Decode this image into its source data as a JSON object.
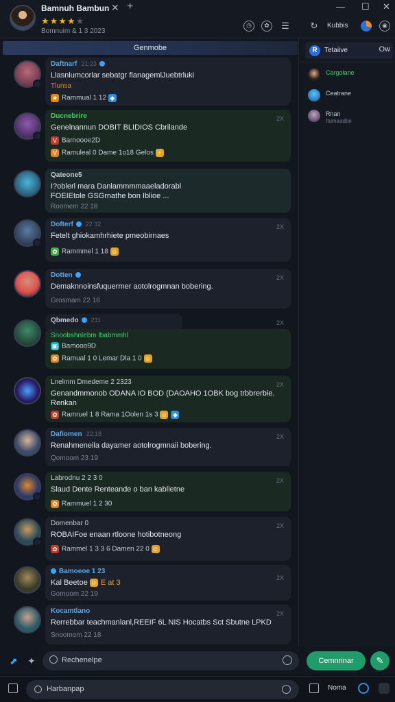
{
  "window": {
    "tab_title": "Bamnuh Bambun",
    "rating_stars_on": "★★★★",
    "rating_stars_off": "★",
    "subline": "Bomnuim & 1 3 2023",
    "close_glyph": "✕",
    "add_glyph": "+",
    "minimize_glyph": "—",
    "maximize_glyph": "☐",
    "window_close_glyph": "✕"
  },
  "toolbar": {
    "refresh_label": "Kubbis"
  },
  "feed": {
    "section_title": "Genmobe",
    "messages": [
      {
        "name": "Daftnarf",
        "time": "21:23",
        "text": "Llasnlumcorlar sebatgr flanagemlJuebtrluki",
        "sub": "Tlunsa",
        "meta": "Rammual 1 12",
        "x": ""
      },
      {
        "name": "Ducnebrire",
        "time": "",
        "text": "Genelnannun DOBIT BLIDIOS  Cbrilande",
        "sub": "",
        "meta1": "Barnoooe2D",
        "meta2": "Ramuleal 0  Dame 1o18  Gelos",
        "x": "2X"
      },
      {
        "name": "Qateone5",
        "time": "",
        "text": "I?oblerl mara Danlammmmaaeladorabl",
        "text2": "FOEIEtole GSGrnathe bon Iblioe ...",
        "sub": "Roomem 22 18",
        "x": ""
      },
      {
        "name": "Dofterf",
        "time": "22 32",
        "text": "Fetelt ghiokamhrhiete pmeobirnaes",
        "meta": "Rammmel 1 18",
        "x": "2X"
      },
      {
        "name": "Dotten",
        "time": "",
        "text": "Demaknnoinsfuquermer aotolrogmnan bobering.",
        "sub": "Grosmam 22 18",
        "x": "2X"
      },
      {
        "name": "Qbmedo",
        "time": "211",
        "text": "Snoobshnlebm lbabmmhl",
        "meta1": "Bamooo9D",
        "meta2": "Ramual 1 0  Lemar Dla 1 0",
        "x": "2X"
      },
      {
        "name": "Lnelmm Dmedeme 2 2323",
        "time": "",
        "text": "Genandmmonob ODANA IO BOD (DAOAHO 1OBK bog trbbrerbie.",
        "text2": "Renkan",
        "meta": "Ramruel 1 8  Rama 1Oolen 1s 3",
        "x": "2X"
      },
      {
        "name": "Dafiomen",
        "time": "22:18",
        "text": "Renahmeneila dayamer aotolrogmnaii bobering.",
        "sub": "Qomoom 23 19",
        "x": "2X"
      },
      {
        "name": "Labrodnu 2 2 3 0",
        "time": "",
        "text": "Slaud Dente Renteande o ban kablletne",
        "meta": "Rammuel 1 2 30",
        "x": "2X"
      },
      {
        "name": "Domenbar 0",
        "time": "",
        "text": "ROBAIFoe enaan rtloone hotibotneong",
        "meta": "Rammel 1 3 3 6 Damen 22 0",
        "x": "2X"
      },
      {
        "name": "Bamoeoe 1 23",
        "time": "",
        "text": "Kal Beetoe",
        "text_extra": "E at 3",
        "sub": "Gomoom 22 19",
        "x": "2X"
      },
      {
        "name": "Kocamtlano",
        "time": "",
        "text": "Rerrebbar teachmanlanl,REEIF 6L NIS Hocatbs Sct Sbutne LPKD",
        "sub": "Snoomom 22 18",
        "x": "2X"
      }
    ]
  },
  "right_panel": {
    "chip_label": "Tetaiive",
    "chip_icon": "R",
    "chip_more": "Ow",
    "items": [
      {
        "label": "Cargolane",
        "sub": ""
      },
      {
        "label": "Ceatrane",
        "sub": ""
      },
      {
        "label": "Rnan",
        "sub": "Itumaadbe"
      }
    ]
  },
  "composer": {
    "placeholder": "Rechenelpe",
    "send_label": "Cemnrinar",
    "mic_glyph": "✎",
    "left_icon_1": "⬈",
    "left_icon_2": "✦"
  },
  "taskbar": {
    "search_placeholder": "Harbanpap",
    "right_label": "Noma"
  }
}
